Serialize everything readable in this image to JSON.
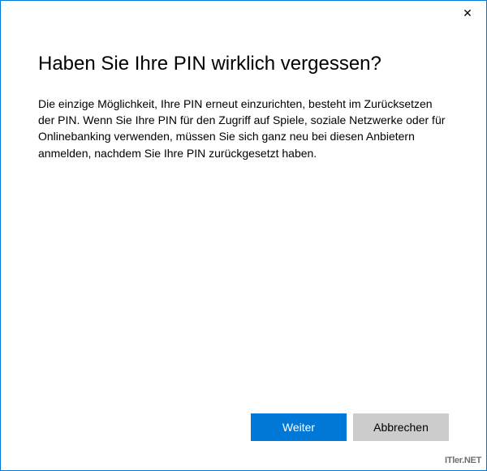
{
  "dialog": {
    "heading": "Haben Sie Ihre PIN wirklich vergessen?",
    "body": "Die einzige Möglichkeit, Ihre PIN erneut einzurichten, besteht im Zurücksetzen der PIN. Wenn Sie Ihre PIN für den Zugriff auf Spiele, soziale Netzwerke oder für Onlinebanking verwenden, müssen Sie sich ganz neu bei diesen Anbietern anmelden, nachdem Sie Ihre PIN zurückgesetzt haben.",
    "buttons": {
      "primary": "Weiter",
      "secondary": "Abbrechen"
    },
    "close_glyph": "✕"
  },
  "watermark": "ITler.NET",
  "colors": {
    "accent": "#0078d7",
    "secondary_button": "#cccccc"
  }
}
